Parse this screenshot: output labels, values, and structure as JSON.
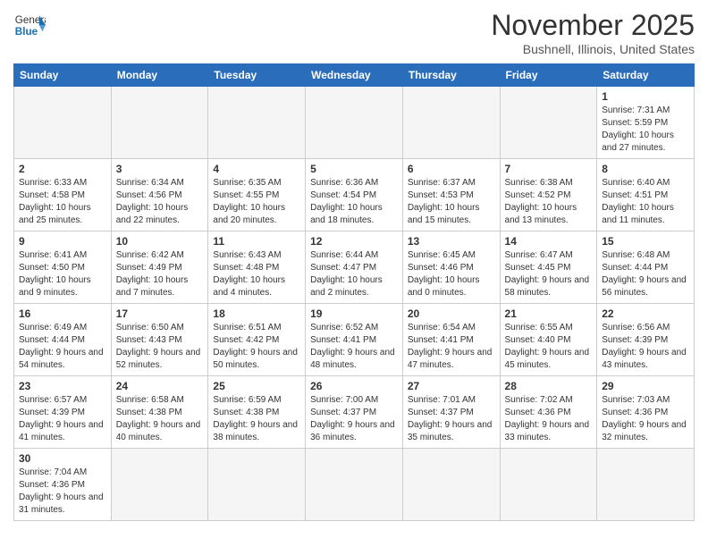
{
  "header": {
    "logo_general": "General",
    "logo_blue": "Blue",
    "title": "November 2025",
    "location": "Bushnell, Illinois, United States"
  },
  "weekdays": [
    "Sunday",
    "Monday",
    "Tuesday",
    "Wednesday",
    "Thursday",
    "Friday",
    "Saturday"
  ],
  "weeks": [
    [
      {
        "day": "",
        "info": ""
      },
      {
        "day": "",
        "info": ""
      },
      {
        "day": "",
        "info": ""
      },
      {
        "day": "",
        "info": ""
      },
      {
        "day": "",
        "info": ""
      },
      {
        "day": "",
        "info": ""
      },
      {
        "day": "1",
        "info": "Sunrise: 7:31 AM\nSunset: 5:59 PM\nDaylight: 10 hours and 27 minutes."
      }
    ],
    [
      {
        "day": "2",
        "info": "Sunrise: 6:33 AM\nSunset: 4:58 PM\nDaylight: 10 hours and 25 minutes."
      },
      {
        "day": "3",
        "info": "Sunrise: 6:34 AM\nSunset: 4:56 PM\nDaylight: 10 hours and 22 minutes."
      },
      {
        "day": "4",
        "info": "Sunrise: 6:35 AM\nSunset: 4:55 PM\nDaylight: 10 hours and 20 minutes."
      },
      {
        "day": "5",
        "info": "Sunrise: 6:36 AM\nSunset: 4:54 PM\nDaylight: 10 hours and 18 minutes."
      },
      {
        "day": "6",
        "info": "Sunrise: 6:37 AM\nSunset: 4:53 PM\nDaylight: 10 hours and 15 minutes."
      },
      {
        "day": "7",
        "info": "Sunrise: 6:38 AM\nSunset: 4:52 PM\nDaylight: 10 hours and 13 minutes."
      },
      {
        "day": "8",
        "info": "Sunrise: 6:40 AM\nSunset: 4:51 PM\nDaylight: 10 hours and 11 minutes."
      }
    ],
    [
      {
        "day": "9",
        "info": "Sunrise: 6:41 AM\nSunset: 4:50 PM\nDaylight: 10 hours and 9 minutes."
      },
      {
        "day": "10",
        "info": "Sunrise: 6:42 AM\nSunset: 4:49 PM\nDaylight: 10 hours and 7 minutes."
      },
      {
        "day": "11",
        "info": "Sunrise: 6:43 AM\nSunset: 4:48 PM\nDaylight: 10 hours and 4 minutes."
      },
      {
        "day": "12",
        "info": "Sunrise: 6:44 AM\nSunset: 4:47 PM\nDaylight: 10 hours and 2 minutes."
      },
      {
        "day": "13",
        "info": "Sunrise: 6:45 AM\nSunset: 4:46 PM\nDaylight: 10 hours and 0 minutes."
      },
      {
        "day": "14",
        "info": "Sunrise: 6:47 AM\nSunset: 4:45 PM\nDaylight: 9 hours and 58 minutes."
      },
      {
        "day": "15",
        "info": "Sunrise: 6:48 AM\nSunset: 4:44 PM\nDaylight: 9 hours and 56 minutes."
      }
    ],
    [
      {
        "day": "16",
        "info": "Sunrise: 6:49 AM\nSunset: 4:44 PM\nDaylight: 9 hours and 54 minutes."
      },
      {
        "day": "17",
        "info": "Sunrise: 6:50 AM\nSunset: 4:43 PM\nDaylight: 9 hours and 52 minutes."
      },
      {
        "day": "18",
        "info": "Sunrise: 6:51 AM\nSunset: 4:42 PM\nDaylight: 9 hours and 50 minutes."
      },
      {
        "day": "19",
        "info": "Sunrise: 6:52 AM\nSunset: 4:41 PM\nDaylight: 9 hours and 48 minutes."
      },
      {
        "day": "20",
        "info": "Sunrise: 6:54 AM\nSunset: 4:41 PM\nDaylight: 9 hours and 47 minutes."
      },
      {
        "day": "21",
        "info": "Sunrise: 6:55 AM\nSunset: 4:40 PM\nDaylight: 9 hours and 45 minutes."
      },
      {
        "day": "22",
        "info": "Sunrise: 6:56 AM\nSunset: 4:39 PM\nDaylight: 9 hours and 43 minutes."
      }
    ],
    [
      {
        "day": "23",
        "info": "Sunrise: 6:57 AM\nSunset: 4:39 PM\nDaylight: 9 hours and 41 minutes."
      },
      {
        "day": "24",
        "info": "Sunrise: 6:58 AM\nSunset: 4:38 PM\nDaylight: 9 hours and 40 minutes."
      },
      {
        "day": "25",
        "info": "Sunrise: 6:59 AM\nSunset: 4:38 PM\nDaylight: 9 hours and 38 minutes."
      },
      {
        "day": "26",
        "info": "Sunrise: 7:00 AM\nSunset: 4:37 PM\nDaylight: 9 hours and 36 minutes."
      },
      {
        "day": "27",
        "info": "Sunrise: 7:01 AM\nSunset: 4:37 PM\nDaylight: 9 hours and 35 minutes."
      },
      {
        "day": "28",
        "info": "Sunrise: 7:02 AM\nSunset: 4:36 PM\nDaylight: 9 hours and 33 minutes."
      },
      {
        "day": "29",
        "info": "Sunrise: 7:03 AM\nSunset: 4:36 PM\nDaylight: 9 hours and 32 minutes."
      }
    ],
    [
      {
        "day": "30",
        "info": "Sunrise: 7:04 AM\nSunset: 4:36 PM\nDaylight: 9 hours and 31 minutes."
      },
      {
        "day": "",
        "info": ""
      },
      {
        "day": "",
        "info": ""
      },
      {
        "day": "",
        "info": ""
      },
      {
        "day": "",
        "info": ""
      },
      {
        "day": "",
        "info": ""
      },
      {
        "day": "",
        "info": ""
      }
    ]
  ]
}
